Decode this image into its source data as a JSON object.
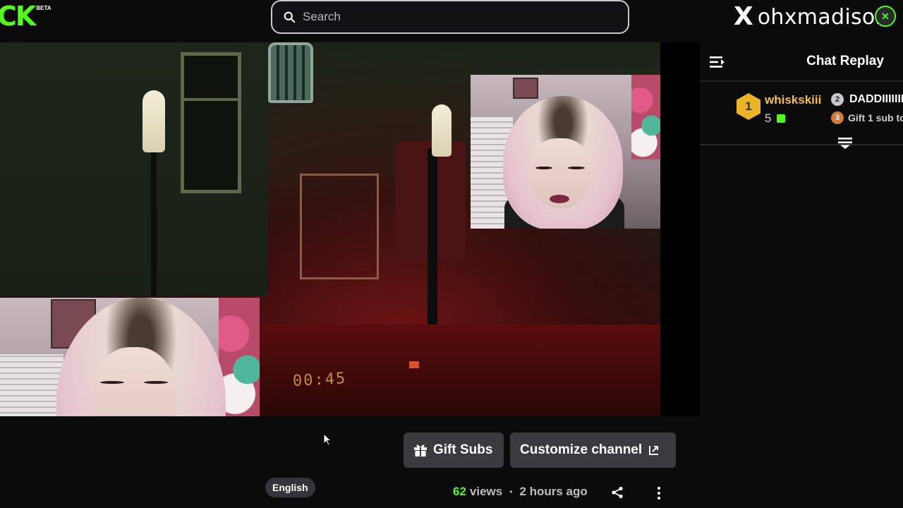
{
  "header": {
    "logo_text": "CK",
    "logo_badge": "BETA",
    "search": {
      "placeholder": "Search"
    },
    "social": {
      "x_glyph": "X",
      "handle": "ohxmadison",
      "avatar_glyph": "✕"
    }
  },
  "video": {
    "clock_display": "00:45"
  },
  "chat": {
    "title": "Chat Replay",
    "leaderboard": [
      {
        "rank": "1",
        "name": "whiskskiii",
        "count": "5"
      },
      {
        "rank": "2",
        "name": "DADDIIIIIII"
      },
      {
        "rank": "3",
        "name": "Gift 1 sub to"
      }
    ]
  },
  "actions": {
    "gift_subs": "Gift Subs",
    "customize": "Customize channel"
  },
  "stream_info": {
    "language": "English",
    "views_count": "62",
    "views_label": "views",
    "separator": "•",
    "time_ago": "2 hours ago"
  },
  "colors": {
    "brand": "#53fc18",
    "gold": "#f2c14a",
    "button_bg": "#3a3a3f"
  }
}
